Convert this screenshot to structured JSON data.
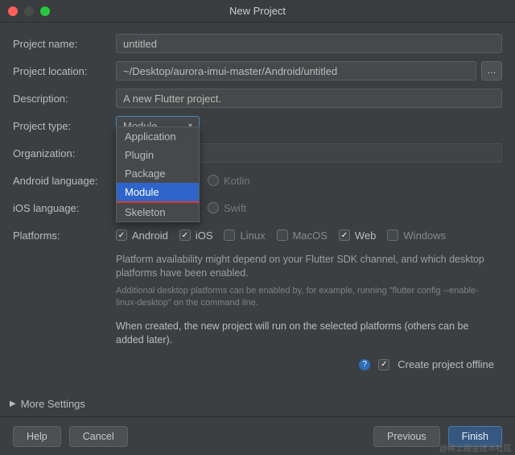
{
  "window": {
    "title": "New Project"
  },
  "labels": {
    "project_name": "Project name:",
    "project_location": "Project location:",
    "description": "Description:",
    "project_type": "Project type:",
    "organization": "Organization:",
    "android_language": "Android language:",
    "ios_language": "iOS language:",
    "platforms": "Platforms:"
  },
  "values": {
    "project_name": "untitled",
    "project_location": "~/Desktop/aurora-imui-master/Android/untitled",
    "description": "A new Flutter project.",
    "organization": ""
  },
  "project_type": {
    "selected": "Module",
    "options": [
      "Application",
      "Plugin",
      "Package",
      "Module",
      "Skeleton"
    ]
  },
  "android_language": {
    "selected_label": "",
    "other": "Kotlin"
  },
  "ios_language": {
    "selected_label": "",
    "other": "Swift"
  },
  "platforms": {
    "items": [
      {
        "label": "Android",
        "checked": true
      },
      {
        "label": "iOS",
        "checked": true
      },
      {
        "label": "Linux",
        "checked": false
      },
      {
        "label": "MacOS",
        "checked": false
      },
      {
        "label": "Web",
        "checked": true
      },
      {
        "label": "Windows",
        "checked": false
      }
    ]
  },
  "info": {
    "availability": "Platform availability might depend on your Flutter SDK channel, and which desktop platforms have been enabled.",
    "hint": "Additional desktop platforms can be enabled by, for example, running \"flutter config --enable-linux-desktop\" on the command line.",
    "created": "When created, the new project will run on the selected platforms (others can be added later)."
  },
  "offline": {
    "label": "Create project offline",
    "checked": true
  },
  "more_settings": "More Settings",
  "buttons": {
    "help": "Help",
    "cancel": "Cancel",
    "previous": "Previous",
    "finish": "Finish",
    "browse": "..."
  },
  "watermark": "@稀土掘金技术社区"
}
